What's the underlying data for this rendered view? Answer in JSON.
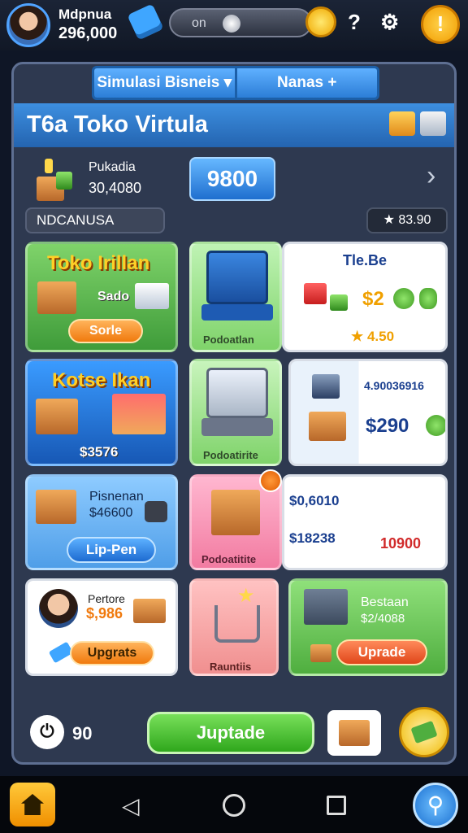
{
  "header": {
    "player_name": "Mdpnua",
    "money": "296,000",
    "toggle_label": "on",
    "help": "?",
    "settings": "⚙"
  },
  "tabs": [
    {
      "label": "Simulasi  Bisneis ▾"
    },
    {
      "label": "Nanas +"
    }
  ],
  "page_title": "T6a Toko Virtula",
  "store": {
    "name": "Pukadia",
    "value": "30,4080",
    "big_number": "9800",
    "label": "NDCANUSA",
    "rating": "★ 83.90"
  },
  "cards": {
    "toko_irillan": {
      "title": "Toko Irillan",
      "sub": "Sado",
      "button": "Sorle"
    },
    "kotse_ikan": {
      "title": "Kotse Ikan",
      "value": "$3576"
    },
    "computer_1": {
      "label": "Podoatlan"
    },
    "computer_2": {
      "label": "Podoatirite"
    },
    "tle": {
      "title": "Tle.Be",
      "price": "$2",
      "rating": "★ 4.50"
    },
    "side_stats": {
      "code": "4.90036916",
      "price": "$290"
    },
    "pisnenan": {
      "title": "Pisnenan",
      "value": "$46600",
      "button": "Lip-Pen"
    },
    "box_pink": {
      "label": "Podoatitite"
    },
    "sale_amounts": {
      "a": "$0,6010",
      "b": "$18238",
      "c": "10900"
    },
    "pertore": {
      "title": "Pertore",
      "value": "$,986",
      "button": "Upgrats"
    },
    "cart": {
      "label": "Rauntiis"
    },
    "bestaan": {
      "title": "Bestaan",
      "value": "$2/4088",
      "button": "Uprade"
    }
  },
  "bottom": {
    "timer_value": "90",
    "upgrade_button": "Juptade"
  },
  "colors": {
    "accent_blue": "#2c7ed7",
    "green_card": "#5cbf5a",
    "pink_card": "#f27ba1",
    "orange_button": "#f07a0e"
  }
}
